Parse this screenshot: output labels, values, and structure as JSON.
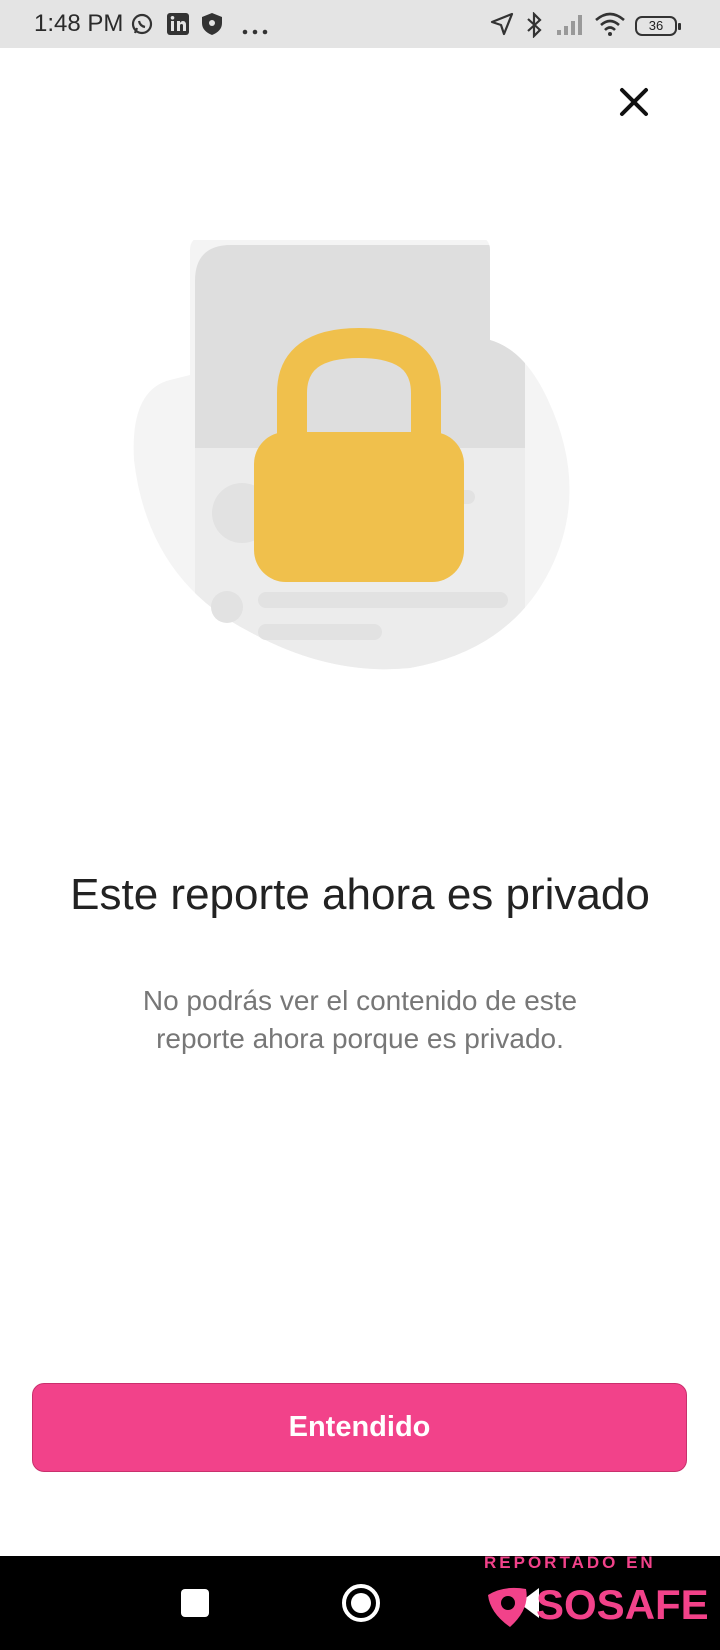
{
  "status_bar": {
    "time": "1:48 PM",
    "left_icons": [
      "whatsapp-icon",
      "linkedin-icon",
      "shield-icon",
      "more-icon"
    ],
    "right_icons": [
      "location-icon",
      "bluetooth-icon",
      "signal-icon",
      "wifi-icon"
    ],
    "battery": "36"
  },
  "dialog": {
    "close_icon": "close-icon",
    "illustration": "locked-report-illustration",
    "title": "Este reporte ahora es privado",
    "description": "No podrás ver el contenido de este reporte ahora porque es privado.",
    "confirm_label": "Entendido"
  },
  "nav_bar": {
    "buttons": [
      "recents-button",
      "home-button",
      "back-button"
    ]
  },
  "watermark": {
    "top_text": "REPORTADO EN",
    "brand": "SOSAFE"
  },
  "colors": {
    "accent": "#f2428a",
    "lock": "#f0c04c",
    "illustration_grey": "#dedede"
  }
}
